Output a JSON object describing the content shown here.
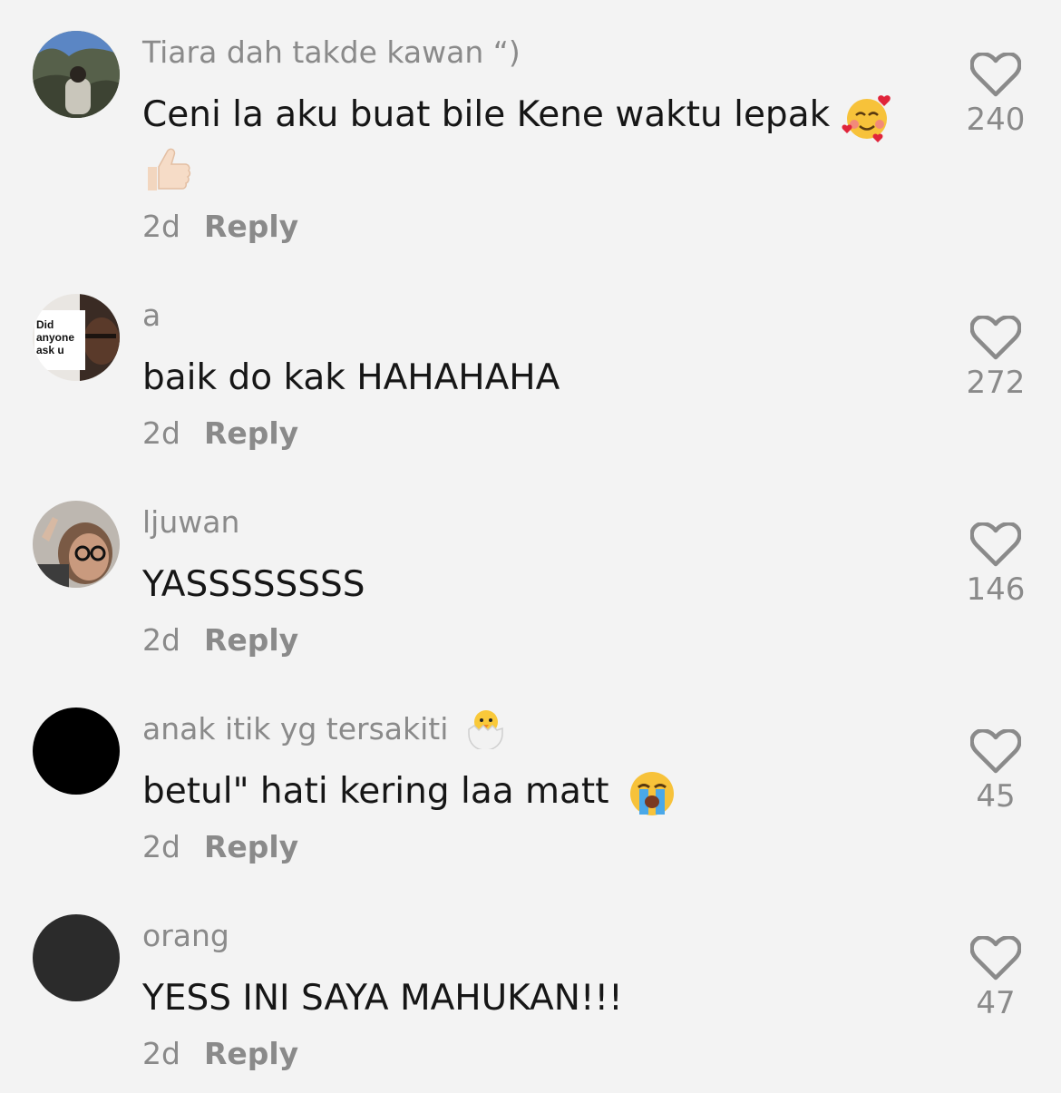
{
  "comments": [
    {
      "username": "Tiara dah takde kawan “)",
      "text": "Ceni la aku buat bile Kene waktu lepak",
      "time": "2d",
      "reply_label": "Reply",
      "likes": "240",
      "avatar": "photo",
      "text_emoji": [
        "smiling-face-with-hearts-emoji",
        "thumbs-up-emoji"
      ]
    },
    {
      "username": "a",
      "text": "baik do kak HAHAHAHA",
      "time": "2d",
      "reply_label": "Reply",
      "likes": "272",
      "avatar": "photo",
      "avatar_text": [
        "Did",
        "anyone",
        "ask u"
      ]
    },
    {
      "username": "ljuwan",
      "text": "YASSSSSSSS",
      "time": "2d",
      "reply_label": "Reply",
      "likes": "146",
      "avatar": "photo"
    },
    {
      "username": "anak itik yg tersakiti",
      "username_emoji": "hatching-chick-emoji",
      "text": "betul\" hati kering laa matt",
      "text_emoji": [
        "loudly-crying-face-emoji"
      ],
      "time": "2d",
      "reply_label": "Reply",
      "likes": "45",
      "avatar": "black",
      "avatar_color": "#000000"
    },
    {
      "username": "orang",
      "text": "YESS INI SAYA MAHUKAN!!!",
      "time": "2d",
      "reply_label": "Reply",
      "likes": "47",
      "avatar": "dark",
      "avatar_color": "#2b2b2b"
    }
  ],
  "colors": {
    "background": "#f3f3f3",
    "username": "#8a8a8a",
    "text": "#161616",
    "meta": "#8a8a8a"
  }
}
